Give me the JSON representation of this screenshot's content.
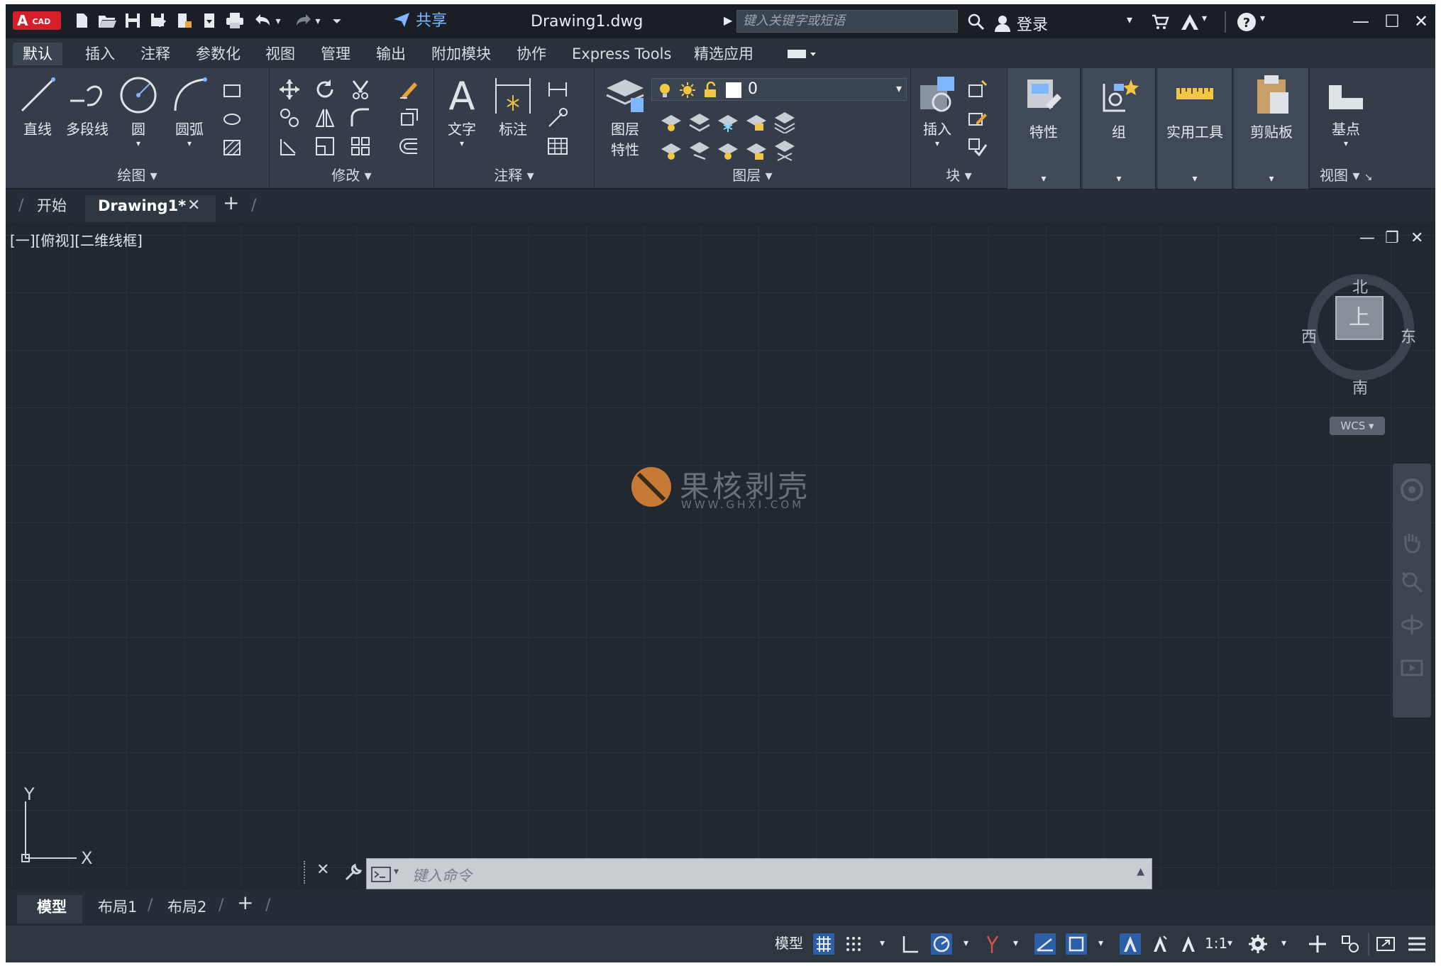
{
  "app": {
    "logo_text": "A",
    "logo_sub": "CAD",
    "doc_title": "Drawing1.dwg",
    "share_label": "共享",
    "search_placeholder": "键入关键字或短语",
    "login_label": "登录",
    "accent_color": "#2d5ea8"
  },
  "menu": {
    "tabs": [
      "默认",
      "插入",
      "注释",
      "参数化",
      "视图",
      "管理",
      "输出",
      "附加模块",
      "协作",
      "Express Tools",
      "精选应用"
    ]
  },
  "ribbon": {
    "draw": {
      "title": "绘图",
      "line": "直线",
      "polyline": "多段线",
      "circle": "圆",
      "arc": "圆弧"
    },
    "modify": {
      "title": "修改"
    },
    "annotation": {
      "title": "注释",
      "text": "文字",
      "dimension": "标注"
    },
    "layers": {
      "title": "图层",
      "layer_props_1": "图层",
      "layer_props_2": "特性",
      "current_layer": "0"
    },
    "block": {
      "title": "块",
      "insert": "插入"
    },
    "properties": "特性",
    "group": "组",
    "utilities": "实用工具",
    "clipboard": "剪贴板",
    "view": {
      "title": "视图",
      "base": "基点"
    }
  },
  "file_tabs": {
    "start": "开始",
    "drawing": "Drawing1*"
  },
  "viewport": {
    "label": "[一][俯视][二维线框]",
    "compass": {
      "north": "北",
      "south": "南",
      "east": "东",
      "west": "西",
      "top": "上"
    },
    "wcs": "WCS",
    "ucs_x": "X",
    "ucs_y": "Y"
  },
  "watermark": {
    "text": "果核剥壳",
    "sub": "WWW.GHXI.COM"
  },
  "command": {
    "placeholder": "键入命令"
  },
  "layout_tabs": [
    "模型",
    "布局1",
    "布局2"
  ],
  "status": {
    "model": "模型",
    "scale": "1:1"
  }
}
